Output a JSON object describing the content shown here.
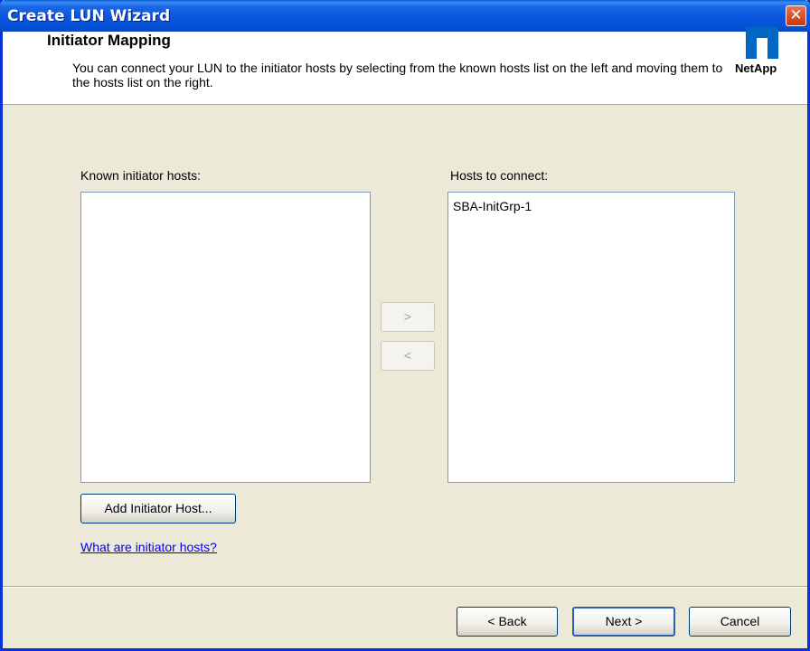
{
  "window": {
    "title": "Create LUN Wizard"
  },
  "header": {
    "title": "Initiator Mapping",
    "description": "You can connect your LUN to the initiator hosts by selecting from the known hosts list on the left and moving them to the hosts list on the right.",
    "logo_text": "NetApp",
    "logo_color": "#0067c5"
  },
  "known_hosts": {
    "label": "Known initiator hosts:",
    "items": []
  },
  "hosts_to_connect": {
    "label": "Hosts to connect:",
    "items": [
      "SBA-InitGrp-1"
    ]
  },
  "move_buttons": {
    "add_label": ">",
    "remove_label": "<"
  },
  "add_initiator_button": "Add Initiator Host...",
  "help_link": "What are initiator hosts?",
  "footer": {
    "back": "< Back",
    "next": "Next >",
    "cancel": "Cancel"
  }
}
